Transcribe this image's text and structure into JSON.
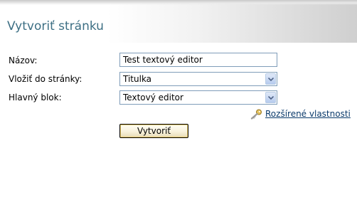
{
  "page": {
    "title": "Vytvoriť stránku"
  },
  "form": {
    "name_label": "Názov:",
    "name_value": "Test textový editor",
    "insert_label": "Vložiť do stránky:",
    "insert_value": "Titulka",
    "block_label": "Hlavný blok:",
    "block_value": "Textový editor",
    "advanced_link": "Rozšírené vlastnosti",
    "create_button": "Vytvoriť"
  },
  "icons": {
    "advanced": "key-icon",
    "dropdown": "chevron-down-icon"
  },
  "colors": {
    "title": "#3d6f84",
    "input_border": "#7f9db9",
    "link": "#0a3a6b"
  }
}
